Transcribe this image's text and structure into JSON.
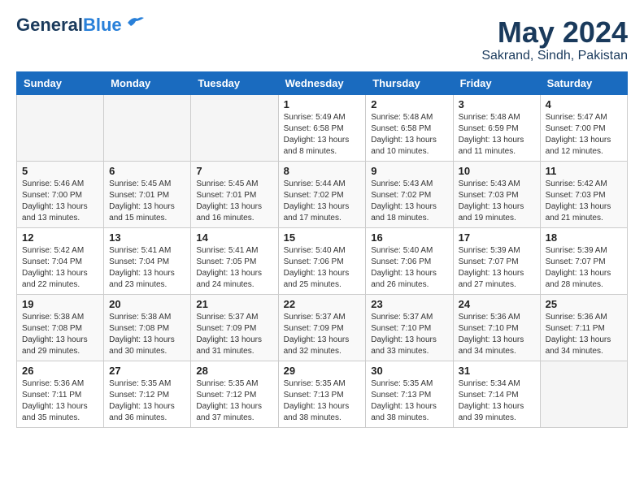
{
  "header": {
    "logo_general": "General",
    "logo_blue": "Blue",
    "month": "May 2024",
    "location": "Sakrand, Sindh, Pakistan"
  },
  "days_of_week": [
    "Sunday",
    "Monday",
    "Tuesday",
    "Wednesday",
    "Thursday",
    "Friday",
    "Saturday"
  ],
  "weeks": [
    [
      {
        "day": "",
        "info": ""
      },
      {
        "day": "",
        "info": ""
      },
      {
        "day": "",
        "info": ""
      },
      {
        "day": "1",
        "info": "Sunrise: 5:49 AM\nSunset: 6:58 PM\nDaylight: 13 hours\nand 8 minutes."
      },
      {
        "day": "2",
        "info": "Sunrise: 5:48 AM\nSunset: 6:58 PM\nDaylight: 13 hours\nand 10 minutes."
      },
      {
        "day": "3",
        "info": "Sunrise: 5:48 AM\nSunset: 6:59 PM\nDaylight: 13 hours\nand 11 minutes."
      },
      {
        "day": "4",
        "info": "Sunrise: 5:47 AM\nSunset: 7:00 PM\nDaylight: 13 hours\nand 12 minutes."
      }
    ],
    [
      {
        "day": "5",
        "info": "Sunrise: 5:46 AM\nSunset: 7:00 PM\nDaylight: 13 hours\nand 13 minutes."
      },
      {
        "day": "6",
        "info": "Sunrise: 5:45 AM\nSunset: 7:01 PM\nDaylight: 13 hours\nand 15 minutes."
      },
      {
        "day": "7",
        "info": "Sunrise: 5:45 AM\nSunset: 7:01 PM\nDaylight: 13 hours\nand 16 minutes."
      },
      {
        "day": "8",
        "info": "Sunrise: 5:44 AM\nSunset: 7:02 PM\nDaylight: 13 hours\nand 17 minutes."
      },
      {
        "day": "9",
        "info": "Sunrise: 5:43 AM\nSunset: 7:02 PM\nDaylight: 13 hours\nand 18 minutes."
      },
      {
        "day": "10",
        "info": "Sunrise: 5:43 AM\nSunset: 7:03 PM\nDaylight: 13 hours\nand 19 minutes."
      },
      {
        "day": "11",
        "info": "Sunrise: 5:42 AM\nSunset: 7:03 PM\nDaylight: 13 hours\nand 21 minutes."
      }
    ],
    [
      {
        "day": "12",
        "info": "Sunrise: 5:42 AM\nSunset: 7:04 PM\nDaylight: 13 hours\nand 22 minutes."
      },
      {
        "day": "13",
        "info": "Sunrise: 5:41 AM\nSunset: 7:04 PM\nDaylight: 13 hours\nand 23 minutes."
      },
      {
        "day": "14",
        "info": "Sunrise: 5:41 AM\nSunset: 7:05 PM\nDaylight: 13 hours\nand 24 minutes."
      },
      {
        "day": "15",
        "info": "Sunrise: 5:40 AM\nSunset: 7:06 PM\nDaylight: 13 hours\nand 25 minutes."
      },
      {
        "day": "16",
        "info": "Sunrise: 5:40 AM\nSunset: 7:06 PM\nDaylight: 13 hours\nand 26 minutes."
      },
      {
        "day": "17",
        "info": "Sunrise: 5:39 AM\nSunset: 7:07 PM\nDaylight: 13 hours\nand 27 minutes."
      },
      {
        "day": "18",
        "info": "Sunrise: 5:39 AM\nSunset: 7:07 PM\nDaylight: 13 hours\nand 28 minutes."
      }
    ],
    [
      {
        "day": "19",
        "info": "Sunrise: 5:38 AM\nSunset: 7:08 PM\nDaylight: 13 hours\nand 29 minutes."
      },
      {
        "day": "20",
        "info": "Sunrise: 5:38 AM\nSunset: 7:08 PM\nDaylight: 13 hours\nand 30 minutes."
      },
      {
        "day": "21",
        "info": "Sunrise: 5:37 AM\nSunset: 7:09 PM\nDaylight: 13 hours\nand 31 minutes."
      },
      {
        "day": "22",
        "info": "Sunrise: 5:37 AM\nSunset: 7:09 PM\nDaylight: 13 hours\nand 32 minutes."
      },
      {
        "day": "23",
        "info": "Sunrise: 5:37 AM\nSunset: 7:10 PM\nDaylight: 13 hours\nand 33 minutes."
      },
      {
        "day": "24",
        "info": "Sunrise: 5:36 AM\nSunset: 7:10 PM\nDaylight: 13 hours\nand 34 minutes."
      },
      {
        "day": "25",
        "info": "Sunrise: 5:36 AM\nSunset: 7:11 PM\nDaylight: 13 hours\nand 34 minutes."
      }
    ],
    [
      {
        "day": "26",
        "info": "Sunrise: 5:36 AM\nSunset: 7:11 PM\nDaylight: 13 hours\nand 35 minutes."
      },
      {
        "day": "27",
        "info": "Sunrise: 5:35 AM\nSunset: 7:12 PM\nDaylight: 13 hours\nand 36 minutes."
      },
      {
        "day": "28",
        "info": "Sunrise: 5:35 AM\nSunset: 7:12 PM\nDaylight: 13 hours\nand 37 minutes."
      },
      {
        "day": "29",
        "info": "Sunrise: 5:35 AM\nSunset: 7:13 PM\nDaylight: 13 hours\nand 38 minutes."
      },
      {
        "day": "30",
        "info": "Sunrise: 5:35 AM\nSunset: 7:13 PM\nDaylight: 13 hours\nand 38 minutes."
      },
      {
        "day": "31",
        "info": "Sunrise: 5:34 AM\nSunset: 7:14 PM\nDaylight: 13 hours\nand 39 minutes."
      },
      {
        "day": "",
        "info": ""
      }
    ]
  ]
}
